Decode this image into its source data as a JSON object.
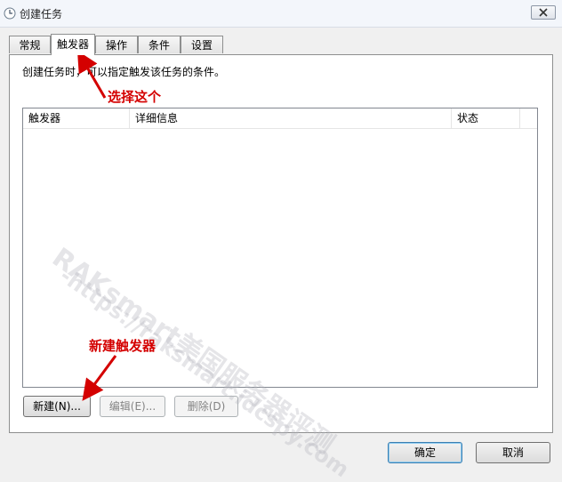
{
  "window": {
    "title": "创建任务"
  },
  "tabs": [
    {
      "label": "常规"
    },
    {
      "label": "触发器"
    },
    {
      "label": "操作"
    },
    {
      "label": "条件"
    },
    {
      "label": "设置"
    }
  ],
  "description": "创建任务时，可以指定触发该任务的条件。",
  "list": {
    "columns": [
      {
        "label": "触发器"
      },
      {
        "label": "详细信息"
      },
      {
        "label": "状态"
      }
    ]
  },
  "buttons": {
    "new": "新建(N)...",
    "edit": "编辑(E)...",
    "delete": "删除(D)",
    "ok": "确定",
    "cancel": "取消"
  },
  "annotations": {
    "select_tab": "选择这个",
    "new_trigger": "新建触发器"
  },
  "watermarks": {
    "brand": "RAKsmart美国服务器评测",
    "url": "-https://raksmart.idcspy.com"
  },
  "colors": {
    "annotation": "#d40000",
    "accent": "#3c7fb1"
  }
}
